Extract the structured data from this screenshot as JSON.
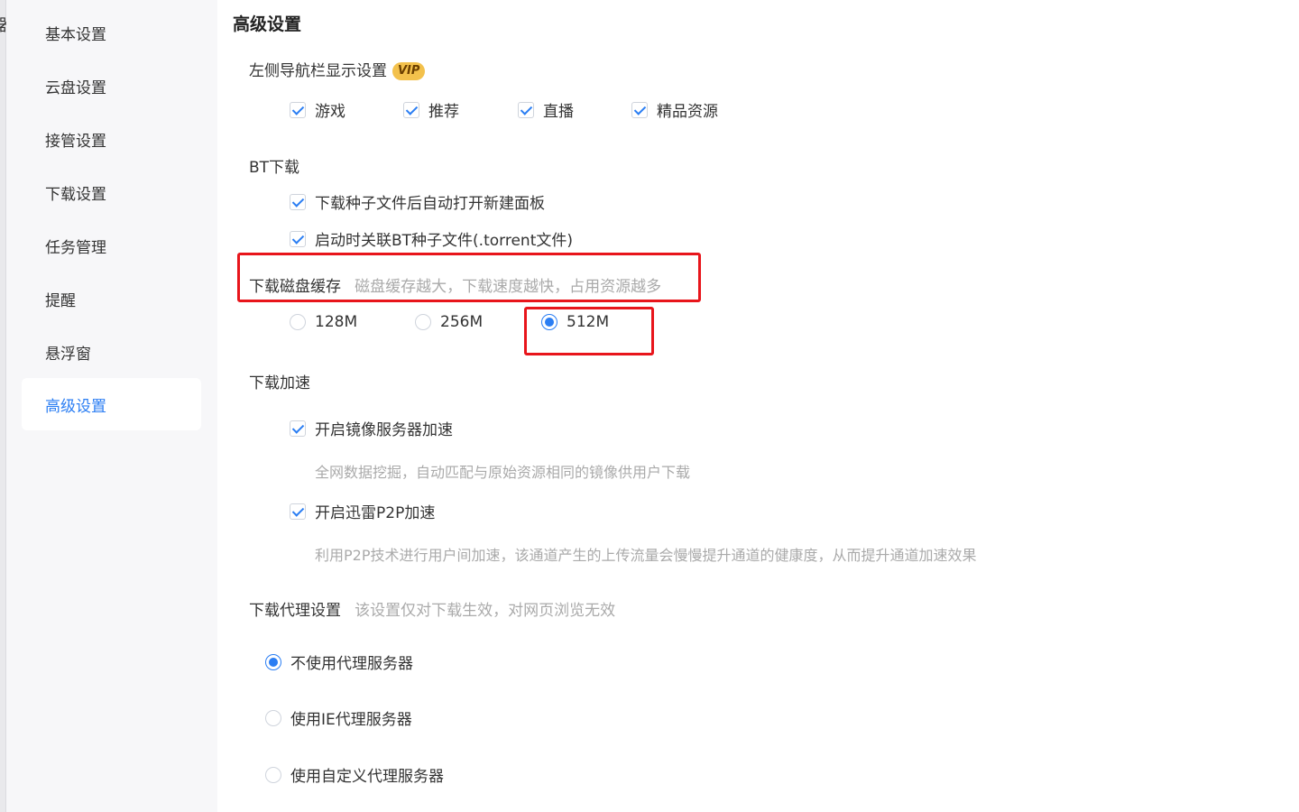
{
  "edge": {
    "glyph": "器"
  },
  "sidebar": {
    "items": [
      {
        "label": "基本设置"
      },
      {
        "label": "云盘设置"
      },
      {
        "label": "接管设置"
      },
      {
        "label": "下载设置"
      },
      {
        "label": "任务管理"
      },
      {
        "label": "提醒"
      },
      {
        "label": "悬浮窗"
      },
      {
        "label": "高级设置",
        "active": true
      }
    ]
  },
  "main": {
    "title": "高级设置",
    "nav_display": {
      "label": "左侧导航栏显示设置",
      "badge": "VIP",
      "options": [
        {
          "label": "游戏",
          "checked": true
        },
        {
          "label": "推荐",
          "checked": true
        },
        {
          "label": "直播",
          "checked": true
        },
        {
          "label": "精品资源",
          "checked": true
        }
      ]
    },
    "bt": {
      "label": "BT下载",
      "options": [
        {
          "label": "下载种子文件后自动打开新建面板",
          "checked": true
        },
        {
          "label": "启动时关联BT种子文件(.torrent文件)",
          "checked": true
        }
      ]
    },
    "disk_cache": {
      "label": "下载磁盘缓存",
      "hint": "磁盘缓存越大，下载速度越快，占用资源越多",
      "options": [
        {
          "label": "128M",
          "selected": false
        },
        {
          "label": "256M",
          "selected": false
        },
        {
          "label": "512M",
          "selected": true
        }
      ]
    },
    "accel": {
      "label": "下载加速",
      "options": [
        {
          "label": "开启镜像服务器加速",
          "checked": true,
          "desc": "全网数据挖掘，自动匹配与原始资源相同的镜像供用户下载"
        },
        {
          "label": "开启迅雷P2P加速",
          "checked": true,
          "desc": "利用P2P技术进行用户间加速，该通道产生的上传流量会慢慢提升通道的健康度，从而提升通道加速效果"
        }
      ]
    },
    "proxy": {
      "label": "下载代理设置",
      "hint": "该设置仅对下载生效，对网页浏览无效",
      "options": [
        {
          "label": "不使用代理服务器",
          "selected": true
        },
        {
          "label": "使用IE代理服务器",
          "selected": false
        },
        {
          "label": "使用自定义代理服务器",
          "selected": false
        }
      ]
    }
  },
  "colors": {
    "accent": "#2b7ef3",
    "annotation": "#e8151b",
    "vip": "#f3c14c"
  }
}
